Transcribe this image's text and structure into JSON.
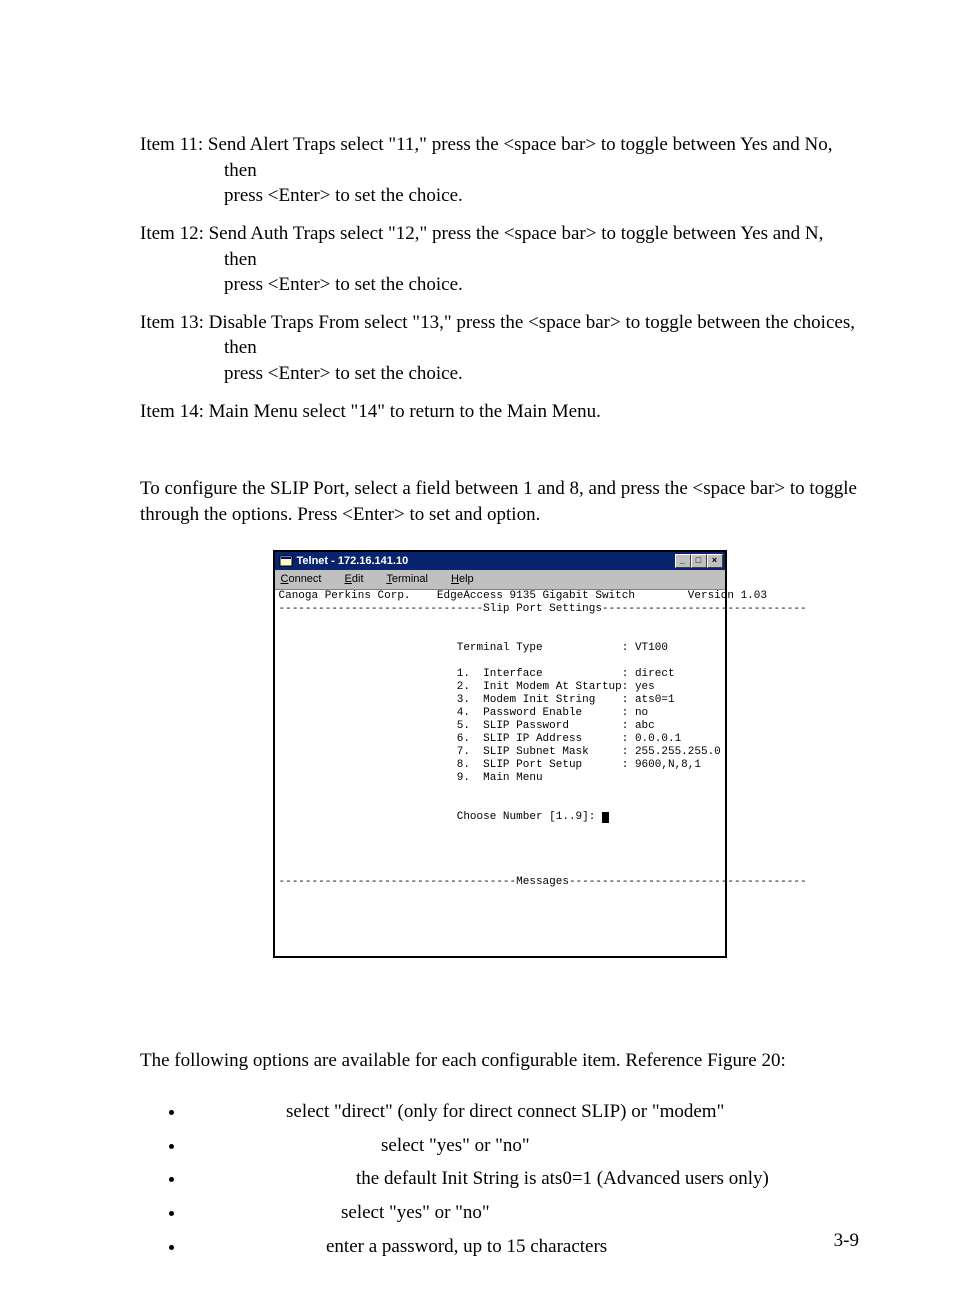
{
  "items": [
    {
      "lead": "Item 11:  Send Alert Traps  select \"11,\" press the <space bar> to toggle between Yes and No, then",
      "cont": "press <Enter> to set the choice."
    },
    {
      "lead": "Item 12:  Send Auth Traps  select \"12,\" press the <space bar> to toggle between Yes and N, then",
      "cont": "press <Enter> to set the choice."
    },
    {
      "lead": "Item 13:  Disable Traps From  select \"13,\" press the <space bar> to toggle between the choices, then",
      "cont": "press <Enter> to set the choice."
    },
    {
      "lead": "Item 14:  Main Menu  select \"14\" to return to the Main Menu.",
      "cont": ""
    }
  ],
  "config_para": "To configure the SLIP Port, select a field between 1 and 8, and press the <space bar> to toggle through the options. Press <Enter> to set and option.",
  "telnet": {
    "title": "Telnet - 172.16.141.10",
    "menu": {
      "c": "C",
      "c2": "onnect",
      "e": "E",
      "e2": "dit",
      "t": "T",
      "t2": "erminal",
      "h": "H",
      "h2": "elp"
    },
    "hdr_left": "Canoga Perkins Corp.",
    "hdr_mid": "EdgeAccess 9135 Gigabit Switch",
    "hdr_right": "Version 1.03",
    "section": "Slip Port Settings",
    "tt_label": "Terminal Type",
    "tt_value": "VT100",
    "rows": [
      {
        "n": "1.",
        "l": "Interface",
        "v": "direct"
      },
      {
        "n": "2.",
        "l": "Init Modem At Startup",
        "v": "yes"
      },
      {
        "n": "3.",
        "l": "Modem Init String",
        "v": "ats0=1"
      },
      {
        "n": "4.",
        "l": "Password Enable",
        "v": "no"
      },
      {
        "n": "5.",
        "l": "SLIP Password",
        "v": "abc"
      },
      {
        "n": "6.",
        "l": "SLIP IP Address",
        "v": "0.0.0.1"
      },
      {
        "n": "7.",
        "l": "SLIP Subnet Mask",
        "v": "255.255.255.0"
      },
      {
        "n": "8.",
        "l": "SLIP Port Setup",
        "v": "9600,N,8,1"
      },
      {
        "n": "9.",
        "l": "Main Menu",
        "v": ""
      }
    ],
    "prompt": "Choose Number [1..9]: ",
    "messages": "Messages"
  },
  "after_para": "The following options are available for each configurable item. Reference Figure 20:",
  "bullets": [
    "select \"direct\" (only for direct connect SLIP) or \"modem\"",
    "select \"yes\" or \"no\"",
    "the default Init String is ats0=1 (Advanced users only)",
    "select \"yes\" or \"no\"",
    "enter a password, up to 15 characters"
  ],
  "bullet_offsets": [
    100,
    195,
    170,
    155,
    140
  ],
  "page_number": "3-9"
}
